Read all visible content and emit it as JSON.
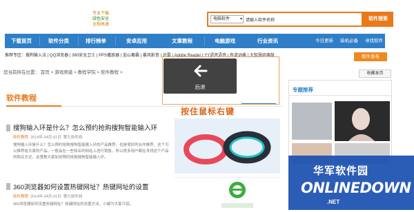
{
  "header": {
    "slogan": [
      "专业下载",
      "绿色安全",
      "全程高速"
    ],
    "search": {
      "category": "电脑软件",
      "placeholder": "请输入软件名称",
      "button": "软件搜索"
    }
  },
  "nav": {
    "items": [
      "下载首页",
      "软件分类",
      "排行榜单",
      "安卓应用",
      "文章教程",
      "电脑游戏",
      "行业资讯"
    ],
    "right": [
      "今日更新",
      "装机必备",
      "寻找软件"
    ]
  },
  "subnav": {
    "label": "推荐专区：",
    "links": "搜狗输入法 | QQ浏览器 | 360安全卫士 | PPS播放器 | 金山毒霸 | 暴风影音 | 迅雷 | Adobe Reader | YY语音语音 | 有道词典 | 大智慧经典版",
    "publish": "软件发布"
  },
  "breadcrumb": {
    "text": "您当前所在位置： 首页 > 游戏频道 > 教程学院 > 软件教程 >",
    "fav": "收藏本页"
  },
  "section": {
    "title": "软件教程"
  },
  "articles": [
    {
      "title": "搜狗输入环是什么？怎么预约抢购搜狗智能输入环",
      "category": "软件教程",
      "date": "2014年-04月-01日",
      "source": "第九软件网",
      "desc": "搜狗输入环是什么？怎么预约抢购搜狗智能输入环的产品推荐，也是很好的合作推荐，这个可以推荐给大家的产品。一般会在一些知名的网站上进行销售，所以很多用户都在寻找这个产品的购买方式，这里教大家如何预约抢购搜狗智能输入环。"
    },
    {
      "title": "360浏览器如何设置热键网址？热键网址的设置",
      "category": "软件教程",
      "date": "2014年-04月-01日",
      "source": "第九软件网",
      "desc": "360浏览器如何设置热键网址？热键网址的设置方法，小编为大家介绍。"
    }
  ],
  "sidebar": {
    "title": "专题推荐"
  },
  "overlay": {
    "back_label": "后退",
    "hint": "按住鼠标右键"
  },
  "watermark": {
    "cn": "华军软件园",
    "en": "ONLINEDOWN",
    "dot": ".NET"
  },
  "colors": {
    "nav": "#2f7fc8",
    "accent": "#e97a1a",
    "watermark": "#1a4fb0"
  }
}
